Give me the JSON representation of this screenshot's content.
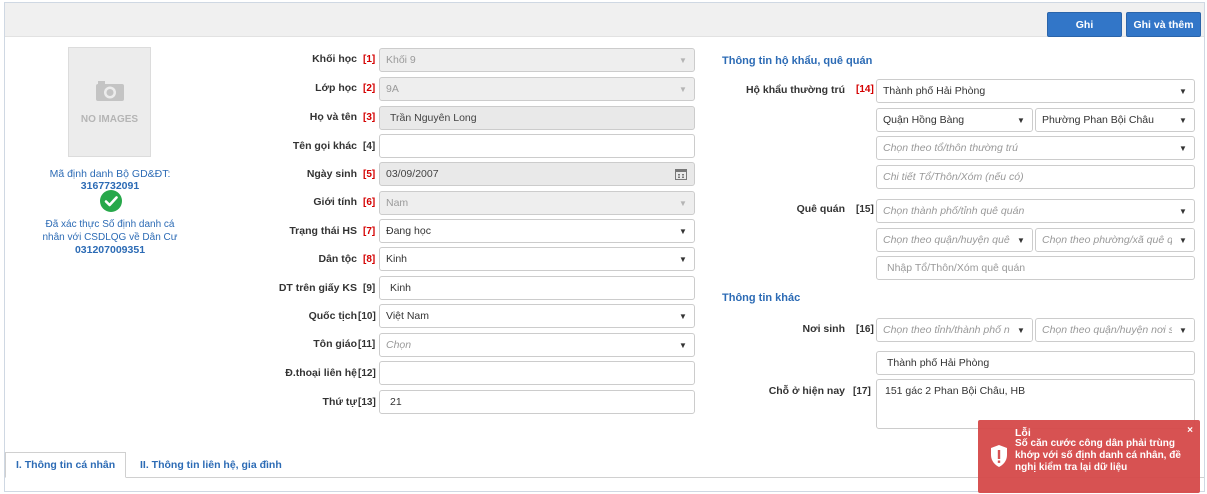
{
  "toolbar": {
    "save_label": "Ghi",
    "save_add_label": "Ghi và thêm"
  },
  "left": {
    "no_images": "NO IMAGES",
    "id_label": "Mã định danh Bộ GD&ĐT:",
    "id_value": "3167732091",
    "verified_line1": "Đã xác thực Số định danh cá",
    "verified_line2": "nhân với CSDLQG về Dân Cư",
    "citizen_id": "031207009351",
    "check_color": "#27a84a"
  },
  "form": {
    "khoi_hoc": {
      "label": "Khối học",
      "num": "[1]",
      "value": "Khối 9"
    },
    "lop_hoc": {
      "label": "Lớp học",
      "num": "[2]",
      "value": "9A"
    },
    "ho_ten": {
      "label": "Họ và tên",
      "num": "[3]",
      "value": "Trần Nguyên Long"
    },
    "ten_goi_khac": {
      "label": "Tên gọi khác",
      "num": "[4]",
      "value": ""
    },
    "ngay_sinh": {
      "label": "Ngày sinh",
      "num": "[5]",
      "value": "03/09/2007"
    },
    "gioi_tinh": {
      "label": "Giới tính",
      "num": "[6]",
      "value": "Nam"
    },
    "trang_thai": {
      "label": "Trạng thái HS",
      "num": "[7]",
      "value": "Đang học"
    },
    "dan_toc": {
      "label": "Dân tộc",
      "num": "[8]",
      "value": "Kinh"
    },
    "dt_giay_ks": {
      "label": "DT trên giấy KS",
      "num": "[9]",
      "value": "Kinh"
    },
    "quoc_tich": {
      "label": "Quốc tịch",
      "num": "[10]",
      "value": "Việt Nam"
    },
    "ton_giao": {
      "label": "Tôn giáo",
      "num": "[11]",
      "value": "Chọn"
    },
    "dien_thoai": {
      "label": "Đ.thoại liên hệ",
      "num": "[12]",
      "value": ""
    },
    "thu_tu": {
      "label": "Thứ tự",
      "num": "[13]",
      "value": "21"
    }
  },
  "household": {
    "title": "Thông tin hộ khẩu, quê quán",
    "ho_khau": {
      "label": "Hộ khẩu thường trú",
      "num": "[14]",
      "province": "Thành phố Hải Phòng",
      "district": "Quận Hồng Bàng",
      "ward": "Phường Phan Bội Châu",
      "hamlet_placeholder": "Chọn theo tổ/thôn thường trú",
      "detail_placeholder": "Chi tiết Tổ/Thôn/Xóm (nếu có)"
    },
    "que_quan": {
      "label": "Quê quán",
      "num": "[15]",
      "province_placeholder": "Chọn thành phố/tỉnh quê quán",
      "district_placeholder": "Chọn theo quận/huyện quê qu",
      "ward_placeholder": "Chọn theo phường/xã quê qua",
      "hamlet_placeholder": "Nhập Tổ/Thôn/Xóm quê quán"
    }
  },
  "other": {
    "title": "Thông tin khác",
    "noi_sinh": {
      "label": "Nơi sinh",
      "num": "[16]",
      "province_placeholder": "Chọn theo tỉnh/thành phố nơi :",
      "district_placeholder": "Chọn theo quận/huyện nơi sin",
      "text": "Thành phố Hải Phòng"
    },
    "cho_o": {
      "label": "Chỗ ở hiện nay",
      "num": "[17]",
      "value": "151 gác 2 Phan Bội Châu, HB"
    }
  },
  "tabs": [
    {
      "label": "I. Thông tin cá nhân"
    },
    {
      "label": "II. Thông tin liên hệ, gia đình"
    }
  ],
  "toast": {
    "title": "Lỗi",
    "message": "Số căn cước công dân phải trùng khớp với số định danh cá nhân, đề nghị kiểm tra lại dữ liệu",
    "close": "×",
    "color": "#d64b4b"
  },
  "icons": {
    "camera": "camera-icon",
    "calendar": "calendar-icon",
    "check": "check-circle-icon",
    "shield": "shield-alert-icon"
  }
}
